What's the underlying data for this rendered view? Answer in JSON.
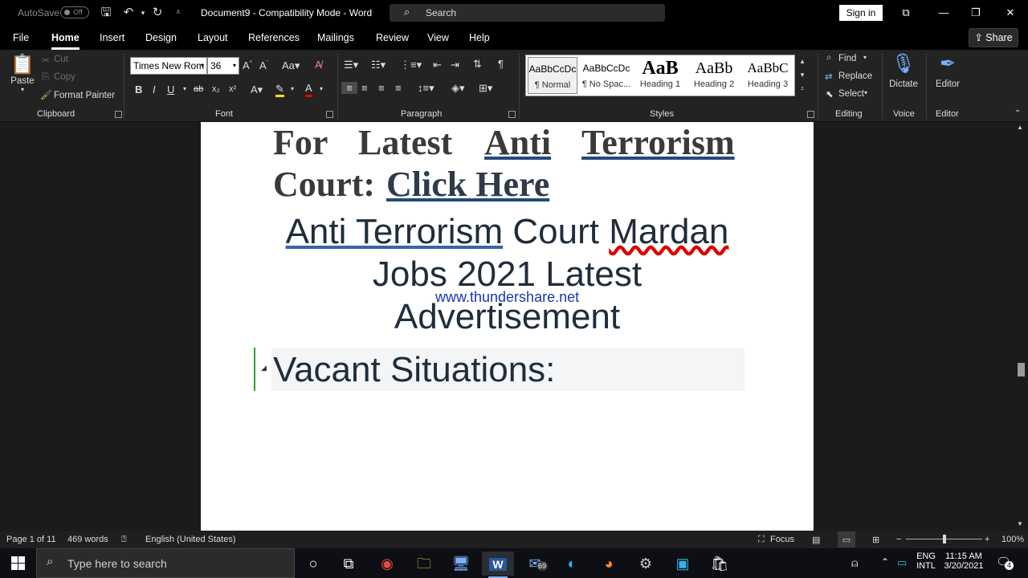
{
  "titlebar": {
    "autosave_label": "AutoSave",
    "autosave_state": "Off",
    "doc_title": "Document9 - Compatibility Mode - Word",
    "search_label": "Search",
    "signin_label": "Sign in"
  },
  "tabs": [
    "File",
    "Home",
    "Insert",
    "Design",
    "Layout",
    "References",
    "Mailings",
    "Review",
    "View",
    "Help"
  ],
  "share_label": "Share",
  "ribbon": {
    "clipboard": {
      "paste": "Paste",
      "cut": "Cut",
      "copy": "Copy",
      "format_painter": "Format Painter",
      "label": "Clipboard"
    },
    "font": {
      "family": "Times New Rom",
      "size": "36",
      "label": "Font"
    },
    "paragraph": {
      "label": "Paragraph"
    },
    "styles": {
      "label": "Styles",
      "items": [
        {
          "preview": "AaBbCcDc",
          "name": "¶ Normal"
        },
        {
          "preview": "AaBbCcDc",
          "name": "¶ No Spac..."
        },
        {
          "preview": "AaB",
          "name": "Heading 1"
        },
        {
          "preview": "AaBb",
          "name": "Heading 2"
        },
        {
          "preview": "AaBbC",
          "name": "Heading 3"
        }
      ]
    },
    "editing": {
      "find": "Find",
      "replace": "Replace",
      "select": "Select",
      "label": "Editing"
    },
    "voice": {
      "dictate": "Dictate",
      "label": "Voice"
    },
    "editor": {
      "editor": "Editor",
      "label": "Editor"
    }
  },
  "document": {
    "line1_words": [
      "For",
      "Latest",
      "Anti",
      "Terrorism"
    ],
    "line2_prefix": "Court:",
    "line2_link": "Click Here",
    "heading_part1": "Anti Terrorism",
    "heading_part2": "Court",
    "heading_part3": "Mardan",
    "heading_line2": "Jobs 2021 Latest",
    "heading_line3": "Advertisement",
    "watermark": "www.thundershare.net",
    "subheading": "Vacant Situations:"
  },
  "status": {
    "page": "Page 1 of 11",
    "words": "469 words",
    "language": "English (United States)",
    "focus": "Focus",
    "zoom": "100%"
  },
  "taskbar": {
    "search_placeholder": "Type here to search",
    "mail_badge": "69",
    "lang1": "ENG",
    "lang2": "INTL",
    "time": "11:15 AM",
    "date": "3/20/2021",
    "notif_count": "4"
  },
  "colors": {
    "accent": "#2b579a",
    "link": "#264a7a",
    "watermark": "#1b36b0"
  }
}
